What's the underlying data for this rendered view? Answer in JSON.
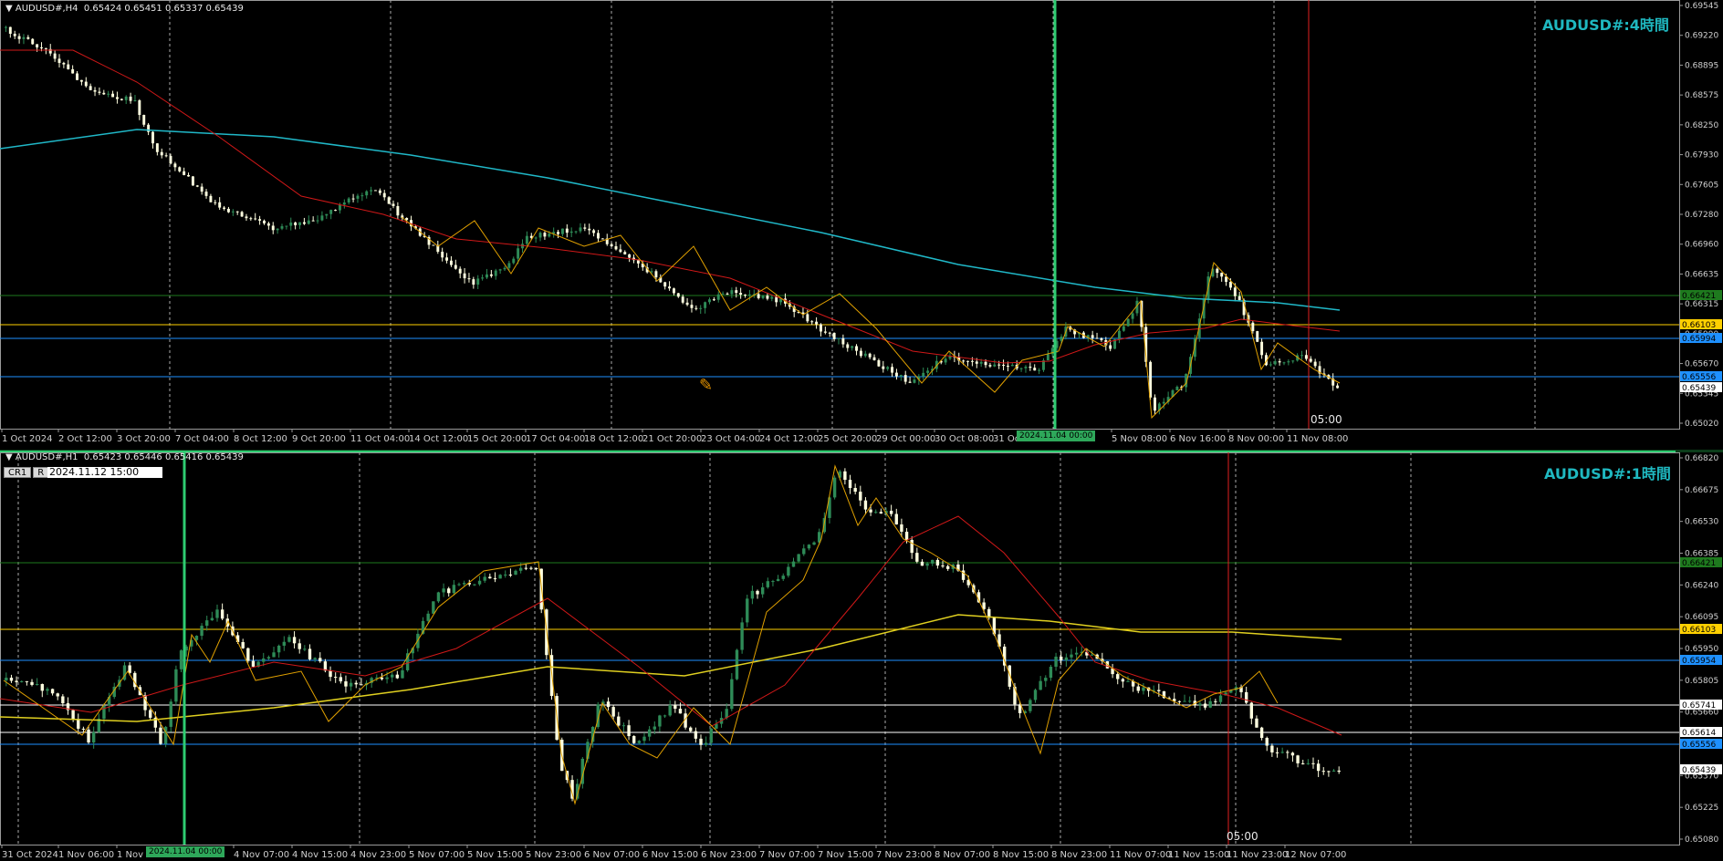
{
  "top_chart": {
    "header": "▼ AUDUSD#,H4  0.65424 0.65451 0.65337 0.65439",
    "title": "AUDUSD#:4時間",
    "y_ticks": [
      "0.69545",
      "0.69220",
      "0.68895",
      "0.68575",
      "0.68250",
      "0.67930",
      "0.67605",
      "0.67280",
      "0.66960",
      "0.66635",
      "0.66315",
      "0.65990",
      "0.65670",
      "0.65345",
      "0.65020"
    ],
    "x_ticks": [
      "1 Oct 2024",
      "2 Oct 12:00",
      "3 Oct 20:00",
      "7 Oct 04:00",
      "8 Oct 12:00",
      "9 Oct 20:00",
      "11 Oct 04:00",
      "14 Oct 12:00",
      "15 Oct 20:00",
      "17 Oct 04:00",
      "18 Oct 12:00",
      "21 Oct 20:00",
      "23 Oct 04:00",
      "24 Oct 12:00",
      "25 Oct 20:00",
      "29 Oct 00:00",
      "30 Oct 08:00",
      "31 Oct",
      "5 Nov 08:00",
      "6 Nov 16:00",
      "8 Nov 00:00",
      "11 Nov 08:00"
    ],
    "price_badges": [
      {
        "text": "0.66421",
        "color": "#1e7a1e",
        "fg": "#000"
      },
      {
        "text": "0.66103",
        "color": "#ffd000",
        "fg": "#000"
      },
      {
        "text": "0.65994",
        "color": "#1e90ff",
        "fg": "#000"
      },
      {
        "text": "0.65556",
        "color": "#1e90ff",
        "fg": "#000"
      },
      {
        "text": "0.65439",
        "color": "#ffffff",
        "fg": "#000"
      }
    ],
    "cursor_date_label": "2024.11.04 00:00",
    "cursor_time_label": "05:00"
  },
  "bottom_chart": {
    "header": "▼ AUDUSD#,H1  0.65423 0.65446 0.65416 0.65439",
    "title": "AUDUSD#:1時間",
    "button_cr": "CR1",
    "button_r": "R",
    "date_input": "2024.11.12 15:00",
    "y_ticks": [
      "0.66820",
      "0.66675",
      "0.66530",
      "0.66385",
      "0.66240",
      "0.66095",
      "0.65950",
      "0.65805",
      "0.65660",
      "0.65515",
      "0.65370",
      "0.65225",
      "0.65080"
    ],
    "x_ticks": [
      "31 Oct 2024",
      "1 Nov 06:00",
      "1 Nov 1",
      "4 Nov 07:00",
      "4 Nov 15:00",
      "4 Nov 23:00",
      "5 Nov 07:00",
      "5 Nov 15:00",
      "5 Nov 23:00",
      "6 Nov 07:00",
      "6 Nov 15:00",
      "6 Nov 23:00",
      "7 Nov 07:00",
      "7 Nov 15:00",
      "7 Nov 23:00",
      "8 Nov 07:00",
      "8 Nov 15:00",
      "8 Nov 23:00",
      "11 Nov 07:00",
      "11 Nov 15:00",
      "11 Nov 23:00",
      "12 Nov 07:00"
    ],
    "price_badges": [
      {
        "text": "0.66421",
        "color": "#1e7a1e",
        "fg": "#000"
      },
      {
        "text": "0.66103",
        "color": "#ffd000",
        "fg": "#000"
      },
      {
        "text": "0.65954",
        "color": "#1e90ff",
        "fg": "#000"
      },
      {
        "text": "0.65741",
        "color": "#ffffff",
        "fg": "#000"
      },
      {
        "text": "0.65614",
        "color": "#ffffff",
        "fg": "#000"
      },
      {
        "text": "0.65556",
        "color": "#1e90ff",
        "fg": "#000"
      },
      {
        "text": "0.65439",
        "color": "#ffffff",
        "fg": "#000"
      }
    ],
    "cursor_date_label": "2024.11.04 00:00",
    "cursor_time_label": "05:00"
  },
  "colors": {
    "background": "#000000",
    "grid": "#a0a0a0",
    "bull": "#2e8b57",
    "bear": "#ffffe0",
    "ma_red": "#d01818",
    "ma_cyan": "#20b8c8",
    "ma_yellow": "#e0d020",
    "zigzag": "#e0a000",
    "accent": "#1fb8c0"
  }
}
